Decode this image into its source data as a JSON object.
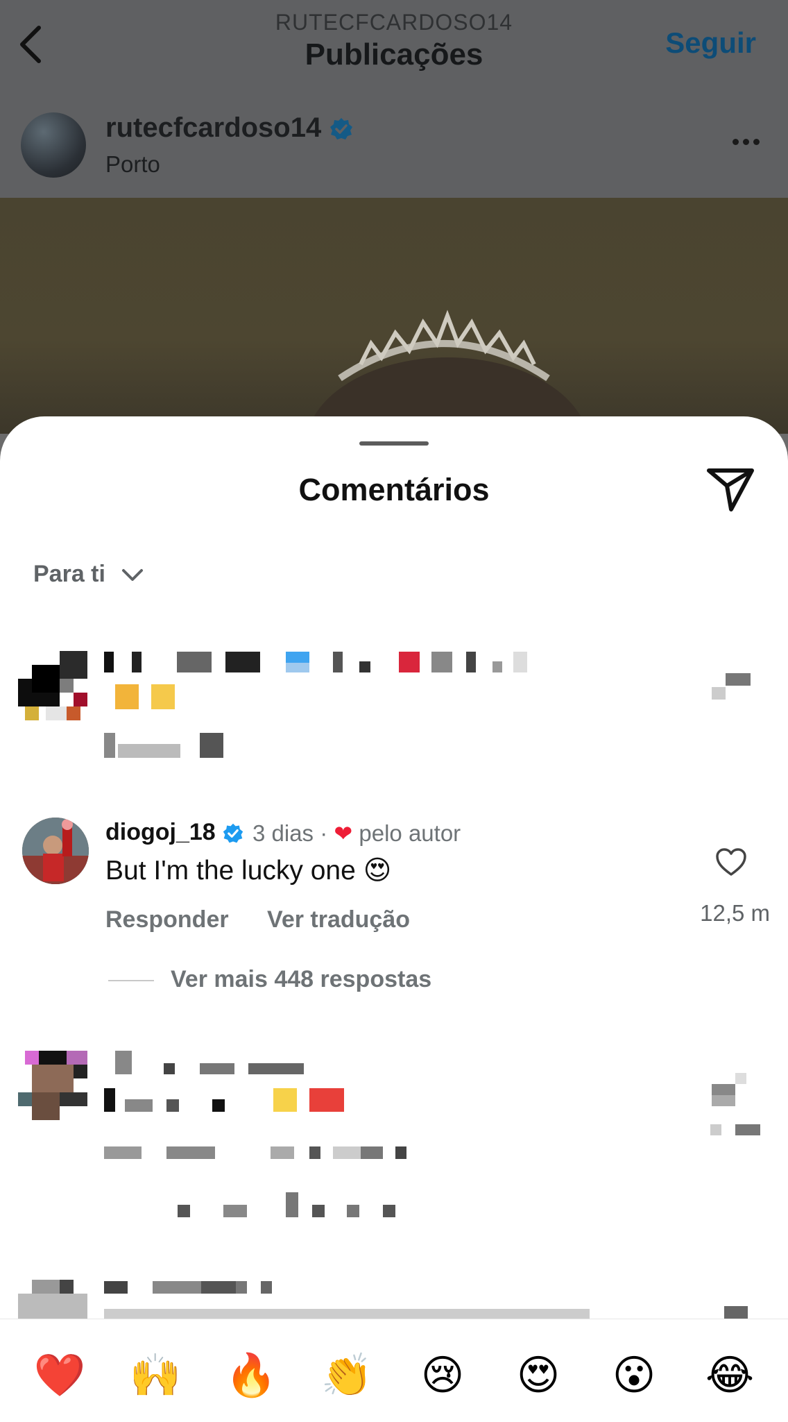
{
  "header": {
    "username_small": "RUTECFCARDOSO14",
    "title": "Publicações",
    "follow_label": "Seguir",
    "back_icon": "chevron-left-icon"
  },
  "post": {
    "username": "rutecfcardoso14",
    "location": "Porto",
    "verified": true
  },
  "sheet": {
    "title": "Comentários",
    "sort_label": "Para ti"
  },
  "comments": [
    {
      "username": "diogoj_18",
      "verified": true,
      "age": "3 dias",
      "meta_separator": "·",
      "liked_by_author": "pelo autor",
      "text": "But I'm the lucky one 😍",
      "reply_label": "Responder",
      "translate_label": "Ver tradução",
      "likes": "12,5 m",
      "more_replies": "Ver mais 448 respostas"
    }
  ],
  "emoji_bar": [
    "❤️",
    "🙌",
    "🔥",
    "👏",
    "😢",
    "😍",
    "😮",
    "😂"
  ],
  "colors": {
    "accent_blue": "#0095f6",
    "heart_red": "#ee1d36",
    "verified_blue": "#1d9bf0"
  }
}
